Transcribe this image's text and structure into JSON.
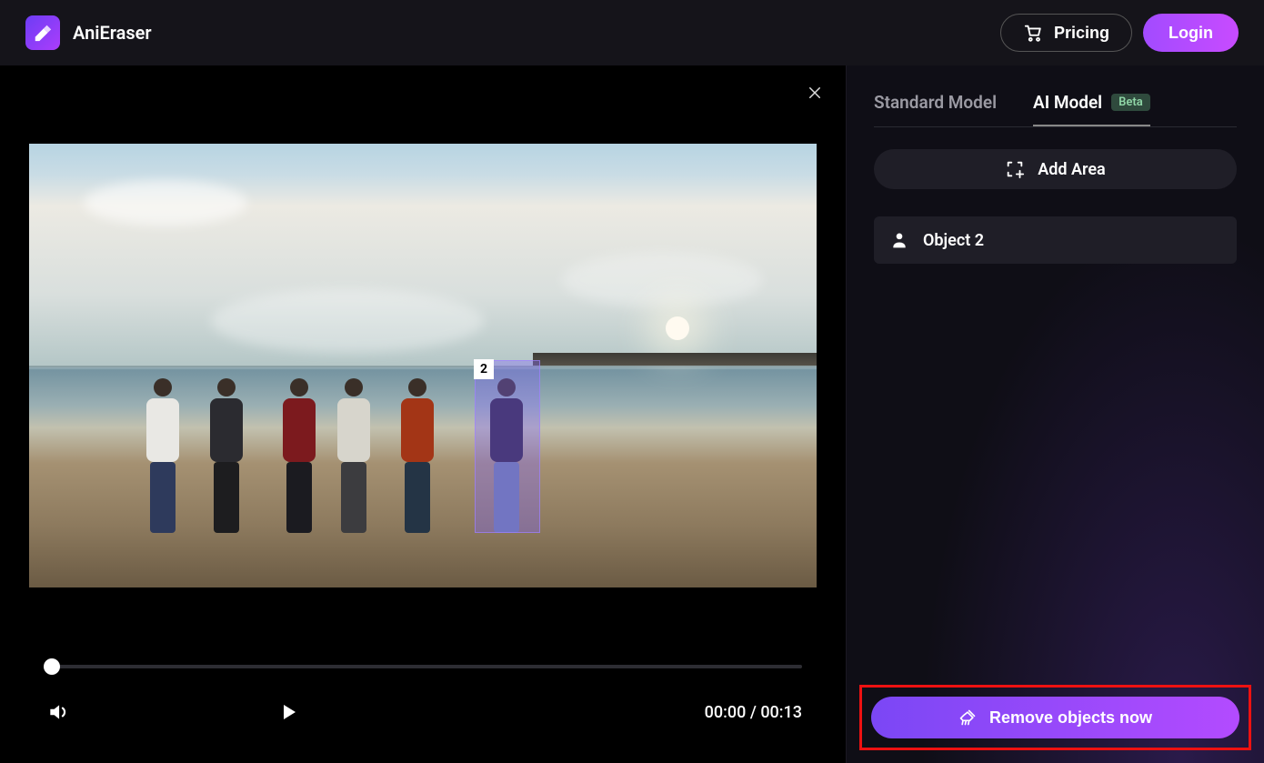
{
  "header": {
    "brand": "AniEraser",
    "pricing": "Pricing",
    "login": "Login"
  },
  "sidebar": {
    "tabs": {
      "standard": "Standard Model",
      "ai": "AI Model",
      "beta_badge": "Beta"
    },
    "add_area": "Add Area",
    "objects": [
      {
        "label": "Object 2"
      }
    ],
    "remove_btn": "Remove objects now"
  },
  "player": {
    "time_current": "00:00",
    "time_separator": " / ",
    "time_total": "00:13",
    "progress_pct": 0
  },
  "selection": {
    "tag": "2"
  }
}
